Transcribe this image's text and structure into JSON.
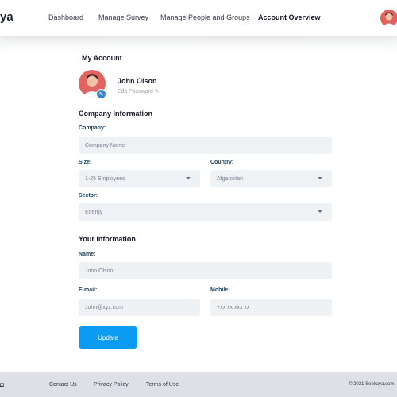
{
  "header": {
    "logo_text": "ya",
    "nav": [
      "Dashboard",
      "Manage Survey",
      "Manage People and Groups",
      "Account Overview"
    ],
    "active_nav": "Account Overview"
  },
  "account": {
    "title": "My Account",
    "user_name": "John Olson",
    "edit_password": "Edit Password"
  },
  "company": {
    "title": "Company Information",
    "company_label": "Company:",
    "company_placeholder": "Company Name",
    "size_label": "Size:",
    "size_value": "1-25 Employees",
    "country_label": "Country:",
    "country_value": "Afganistan",
    "sector_label": "Sector:",
    "sector_value": "Energy"
  },
  "your_info": {
    "title": "Your Information",
    "name_label": "Name:",
    "name_placeholder": "John Olson",
    "email_label": "E-mail:",
    "email_placeholder": "John@xyz.com",
    "mobile_label": "Mobile:",
    "mobile_placeholder": "+xx xx xxx xx"
  },
  "update_label": "Update",
  "footer": {
    "links": [
      "Contact Us",
      "Privacy Policy",
      "Terms of Use"
    ],
    "copyright": "© 2021 Seekaya.com."
  },
  "colors": {
    "accent": "#0b9bf3",
    "field_bg": "#eff2f5",
    "label": "#1d4560",
    "footer_bg": "#dde1e7",
    "avatar_bg": "#e0635f"
  }
}
